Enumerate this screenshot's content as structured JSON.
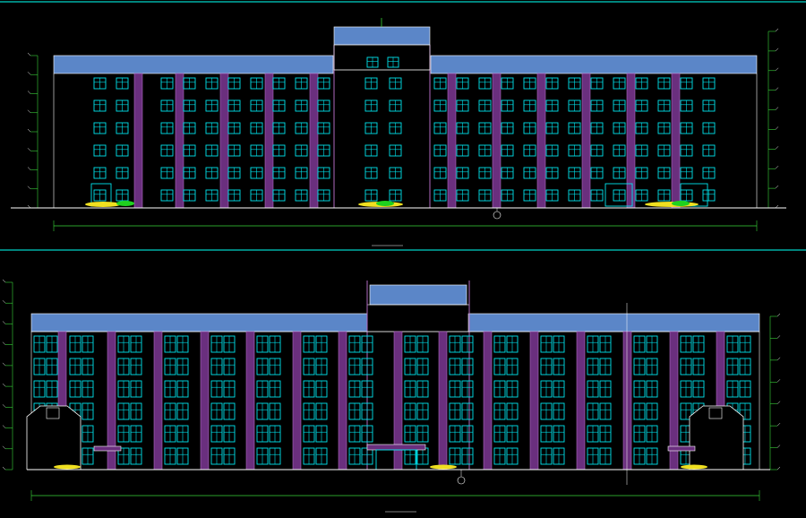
{
  "drawing": {
    "colors": {
      "background": "#000000",
      "frame": "#00d2c8",
      "roof": "#5b86c8",
      "window": "#00e5ee",
      "pilaster": "#b06ac0",
      "column_fill": "#6a2f7e",
      "dimension": "#39d439",
      "ground": "#ffffff",
      "landscape": "#f0e020"
    }
  }
}
